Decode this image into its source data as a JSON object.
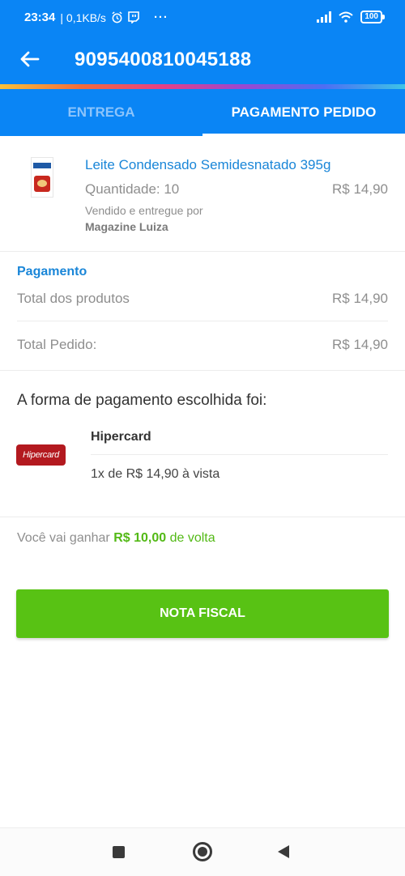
{
  "status_bar": {
    "time": "23:34",
    "network_speed": "| 0,1KB/s",
    "more": "···",
    "battery": "100"
  },
  "app_bar": {
    "order_number": "9095400810045188"
  },
  "tabs": [
    {
      "label": "ENTREGA",
      "active": false
    },
    {
      "label": "PAGAMENTO PEDIDO",
      "active": true
    }
  ],
  "product": {
    "name": "Leite Condensado Semidesnatado 395g",
    "quantity": "Quantidade: 10",
    "price": "R$ 14,90",
    "seller_label": "Vendido e entregue por",
    "seller_name": "Magazine Luiza"
  },
  "payment": {
    "title": "Pagamento",
    "rows": [
      {
        "label": "Total dos produtos",
        "value": "R$ 14,90"
      },
      {
        "label": "Total Pedido:",
        "value": "R$ 14,90"
      }
    ]
  },
  "method": {
    "heading": "A forma de pagamento escolhida foi:",
    "card_logo_text": "Hipercard",
    "card_name": "Hipercard",
    "installment": "1x de R$ 14,90 à vista"
  },
  "cashback": {
    "prefix": "Você vai ganhar",
    "amount": "R$ 10,00",
    "suffix": "de volta"
  },
  "actions": {
    "nota_fiscal": "NOTA FISCAL"
  },
  "colors": {
    "primary": "#0a85f5",
    "link": "#1a86d8",
    "success": "#58c214",
    "card_brand": "#b3191f"
  }
}
